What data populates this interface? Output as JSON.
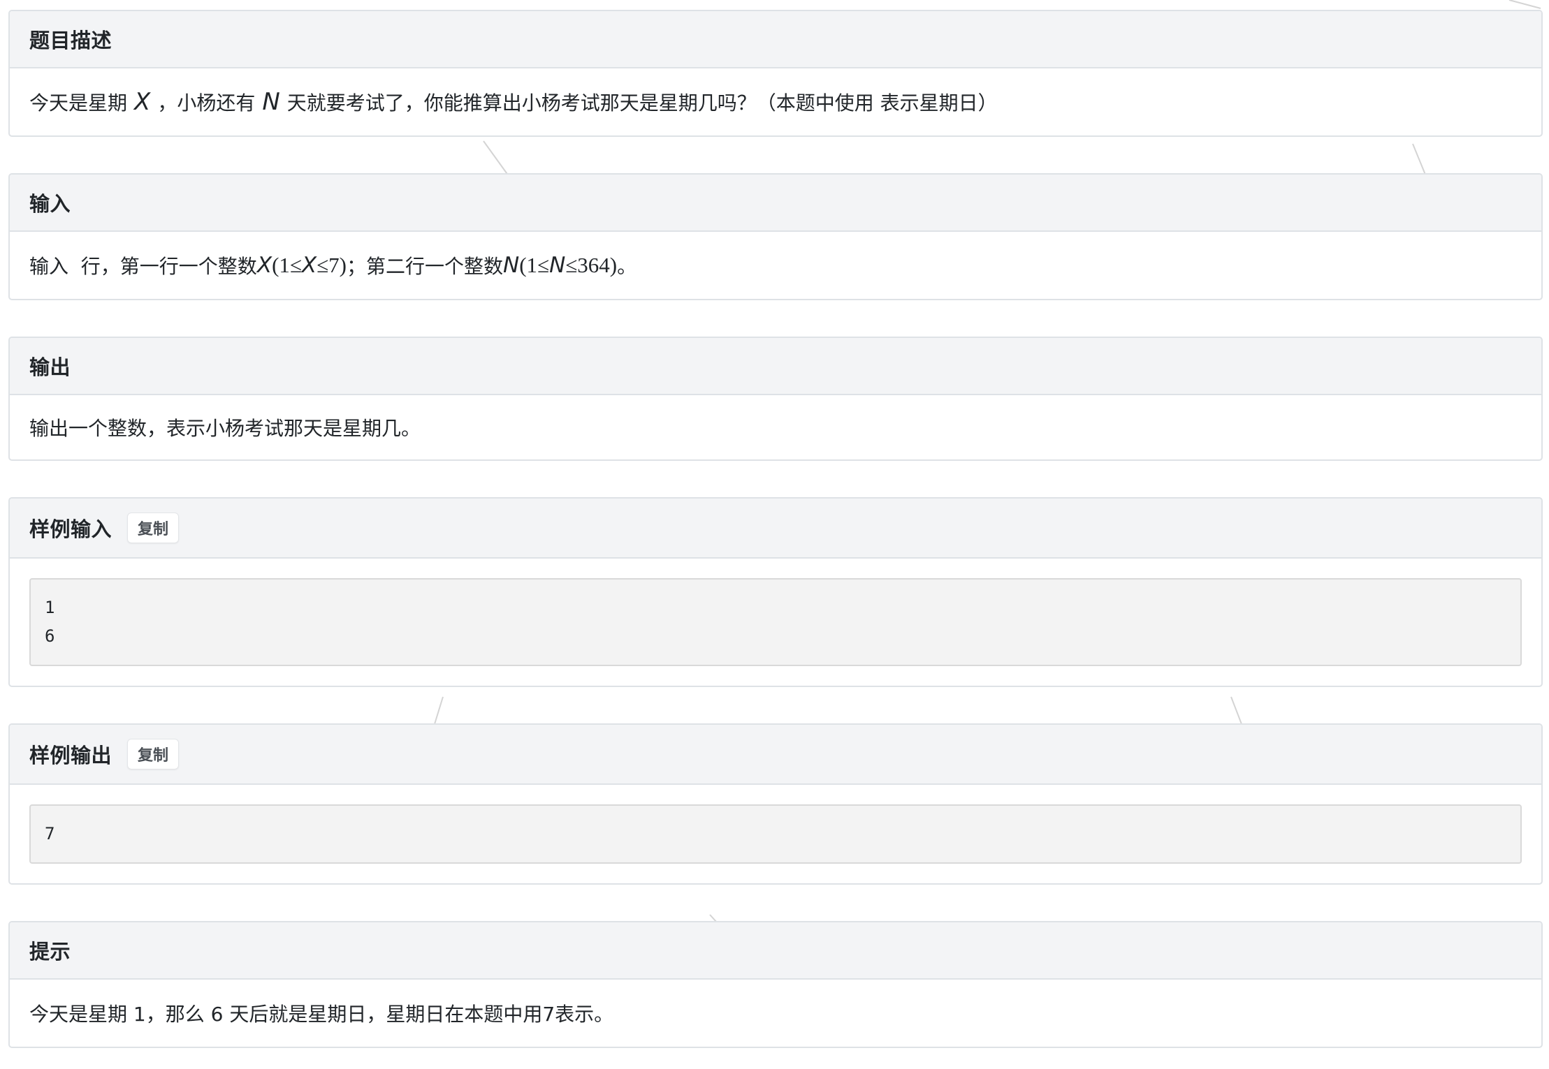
{
  "description": {
    "title": "题目描述",
    "text_prefix": "今天是星期",
    "var_x": "X",
    "text_mid": "，小杨还有",
    "var_n": "N",
    "text_suffix": "天就要考试了，你能推算出小杨考试那天是星期几吗？（本题中使用 表示星期日）"
  },
  "input": {
    "title": "输入",
    "text_a": "输入  行，第一行一个整数",
    "cons1_var": "X",
    "cons1_open": "(1≤",
    "cons1_close": "≤7)",
    "text_b": "；第二行一个整数",
    "cons2_var": "N",
    "cons2_open": "(1≤",
    "cons2_close": "≤364)",
    "text_c": "。"
  },
  "output": {
    "title": "输出",
    "text": "输出一个整数，表示小杨考试那天是星期几。"
  },
  "sample_input": {
    "title": "样例输入",
    "copy_label": "复制",
    "content": "1\n6"
  },
  "sample_output": {
    "title": "样例输出",
    "copy_label": "复制",
    "content": "7"
  },
  "hint": {
    "title": "提示",
    "text": "今天是星期 1，那么 6 天后就是星期日，星期日在本题中用7表示。"
  }
}
